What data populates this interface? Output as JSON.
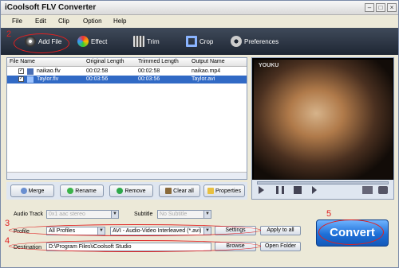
{
  "app": {
    "title": "iCoolsoft FLV Converter"
  },
  "menu": {
    "file": "File",
    "edit": "Edit",
    "clip": "Clip",
    "option": "Option",
    "help": "Help"
  },
  "toolbar": {
    "add_file": "Add File",
    "effect": "Effect",
    "trim": "Trim",
    "crop": "Crop",
    "preferences": "Preferences"
  },
  "table": {
    "headers": [
      "File Name",
      "Original Length",
      "Trimmed Length",
      "Output Name"
    ],
    "rows": [
      {
        "name": "naikao.flv",
        "original": "00:02:58",
        "trimmed": "00:02:58",
        "output": "naikao.mp4",
        "checked": true
      },
      {
        "name": "Taylor.flv",
        "original": "00:03:56",
        "trimmed": "00:03:56",
        "output": "Taylor.avi",
        "checked": true
      }
    ]
  },
  "panel_buttons": {
    "merge": "Merge",
    "rename": "Rename",
    "remove": "Remove",
    "clear_all": "Clear all",
    "properties": "Properties"
  },
  "preview": {
    "watermark": "YOUKU"
  },
  "settings": {
    "audio_track_label": "Audio Track",
    "audio_track_value": "0x1 aac stereo",
    "subtitle_label": "Subtitle",
    "subtitle_value": "No Subtitle",
    "profile_label": "Profile",
    "profile_value": "All Profiles",
    "format_value": "AVI - Audio-Video Interleaved (*.avi)",
    "settings_button": "Settings",
    "apply_all_button": "Apply to all",
    "destination_label": "Destination",
    "destination_value": "D:\\Program Files\\iCoolsoft Studio",
    "browse_button": "Browse",
    "open_folder_button": "Open Folder"
  },
  "convert_button": "Convert",
  "annotations": {
    "a2": "2",
    "a3": "3",
    "a4": "4",
    "a5": "5"
  },
  "colors": {
    "toolbar_bg": "#1e2633",
    "selection": "#316ac5",
    "convert": "#1d6fd8",
    "annotation": "#e02020"
  }
}
